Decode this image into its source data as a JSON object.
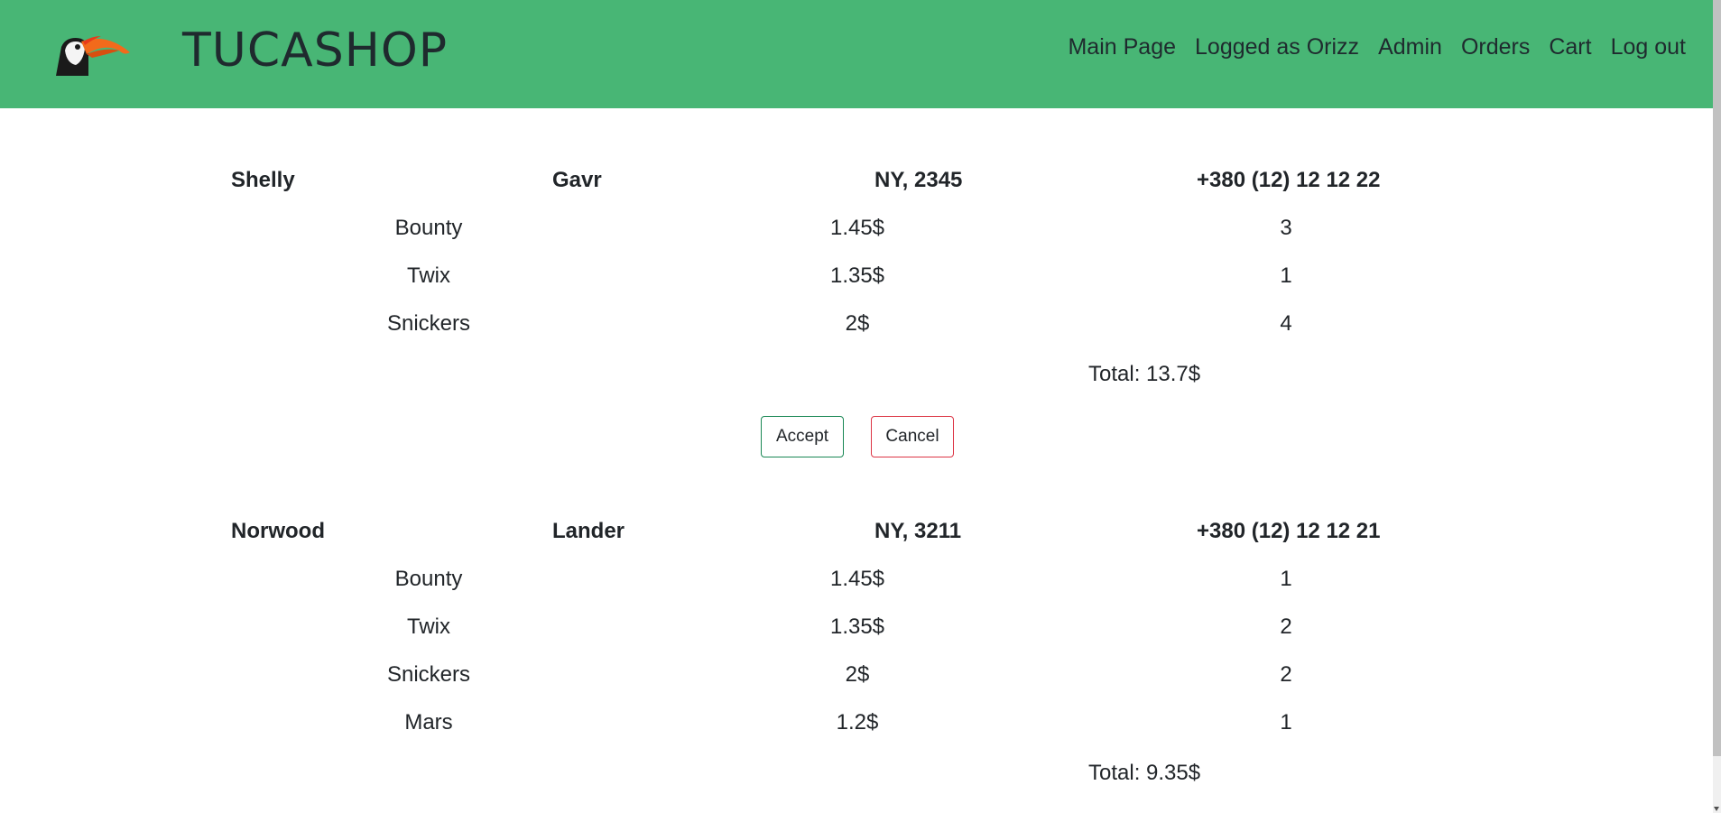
{
  "header": {
    "brand": "TUCASHOP",
    "logo_icon": "toucan-logo-icon",
    "nav": [
      {
        "label": "Main Page"
      },
      {
        "label": "Logged as Orizz"
      },
      {
        "label": "Admin"
      },
      {
        "label": "Orders"
      },
      {
        "label": "Cart"
      },
      {
        "label": "Log out"
      }
    ],
    "bg_color": "#48b675"
  },
  "orders": [
    {
      "first_name": "Shelly",
      "last_name": "Gavr",
      "address": "NY, 2345",
      "phone": "+380 (12) 12 12 22",
      "items": [
        {
          "name": "Bounty",
          "price": "1.45$",
          "qty": "3"
        },
        {
          "name": "Twix",
          "price": "1.35$",
          "qty": "1"
        },
        {
          "name": "Snickers",
          "price": "2$",
          "qty": "4"
        }
      ],
      "total": "Total: 13.7$",
      "accept_label": "Accept",
      "cancel_label": "Cancel"
    },
    {
      "first_name": "Norwood",
      "last_name": "Lander",
      "address": "NY, 3211",
      "phone": "+380 (12) 12 12 21",
      "items": [
        {
          "name": "Bounty",
          "price": "1.45$",
          "qty": "1"
        },
        {
          "name": "Twix",
          "price": "1.35$",
          "qty": "2"
        },
        {
          "name": "Snickers",
          "price": "2$",
          "qty": "2"
        },
        {
          "name": "Mars",
          "price": "1.2$",
          "qty": "1"
        }
      ],
      "total": "Total: 9.35$"
    }
  ]
}
